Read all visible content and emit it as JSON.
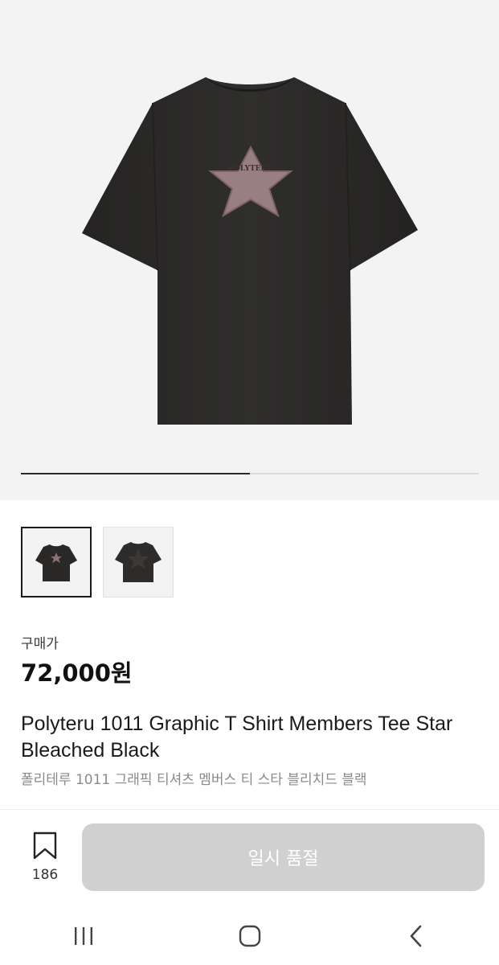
{
  "product": {
    "price_label": "구매가",
    "price": "72,000원",
    "title": "Polyteru 1011 Graphic T Shirt Members Tee Star Bleached Black",
    "subtitle": "폴리테루 1011 그래픽 티셔츠 멤버스 티 스타 블리치드 블랙",
    "print_text": "POLYTERU"
  },
  "gallery": {
    "image_count": 2,
    "current_index": 1,
    "slider_progress": 0.5
  },
  "actions": {
    "bookmark_count": "186",
    "soldout_label": "일시 품절"
  },
  "icons": {
    "bookmark": "bookmark-icon",
    "recent_apps": "recent-apps-icon",
    "home": "home-icon",
    "back": "back-icon"
  },
  "colors": {
    "shirt": "#2b2a29",
    "star": "#9a7f82",
    "button_disabled": "#d0d0d0"
  }
}
